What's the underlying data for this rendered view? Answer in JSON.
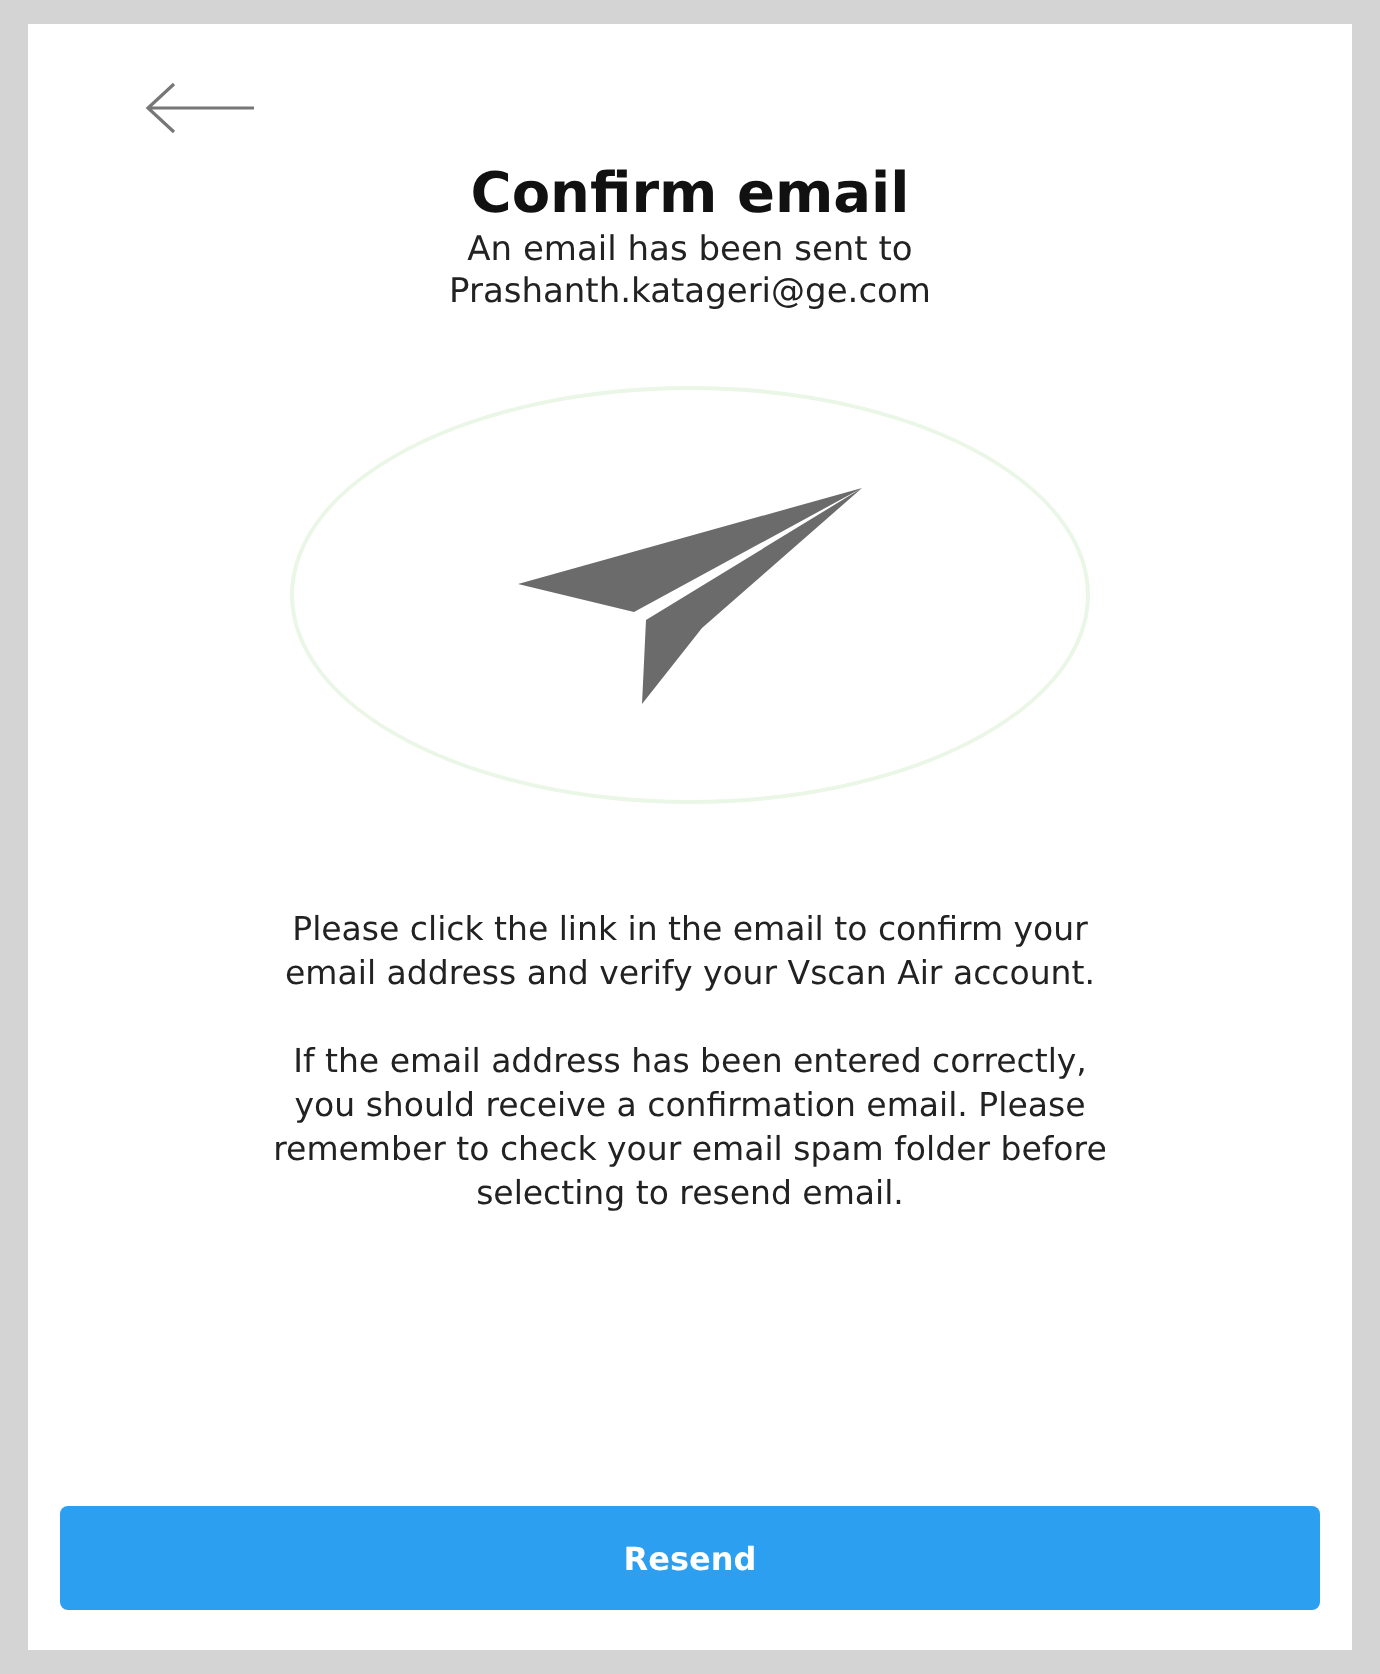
{
  "title": "Confirm email",
  "subtitle": [
    "An email has been sent to",
    "Prashanth.katageri@ge.com"
  ],
  "paragraphs": [
    "Please click the link in the email to confirm your email address and verify your Vscan Air account.",
    "If the email address has been entered correctly, you should receive a confirmation email. Please remember to check your email spam folder before selecting to resend email."
  ],
  "button": "Resend"
}
